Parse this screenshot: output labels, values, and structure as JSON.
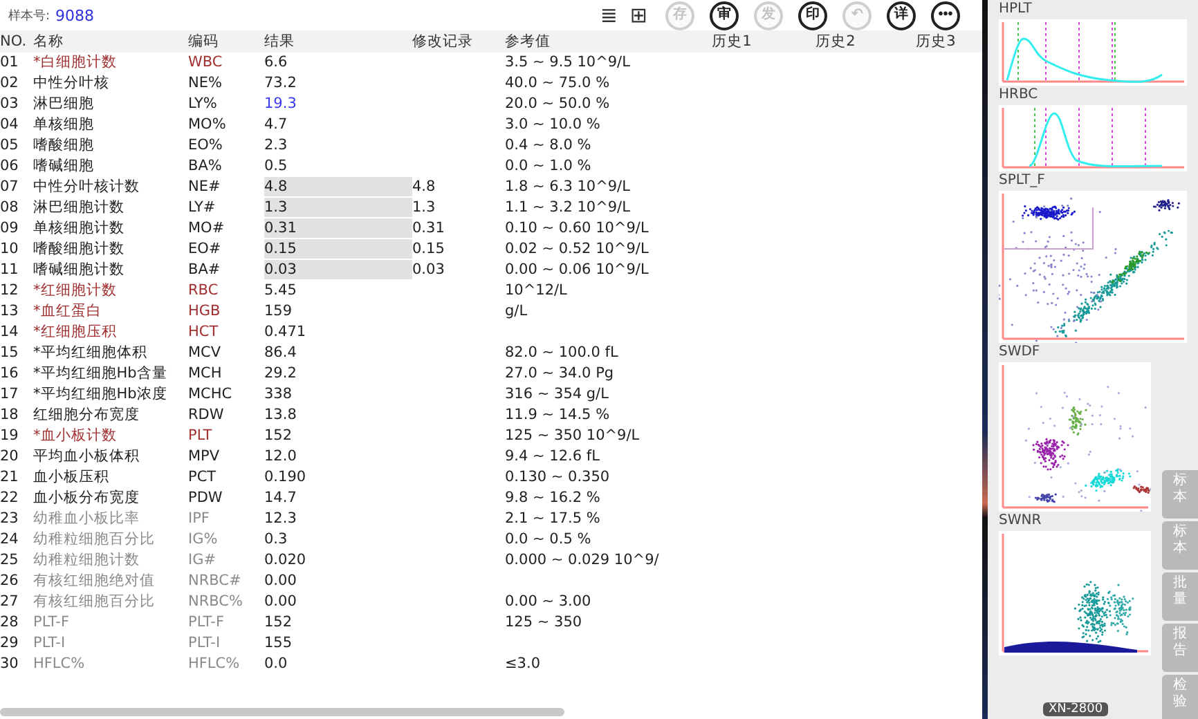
{
  "sample": {
    "label": "样本号:",
    "value": "9088"
  },
  "toolbar": [
    {
      "kind": "icon",
      "label": "≣"
    },
    {
      "kind": "icon",
      "label": "⊞"
    },
    {
      "kind": "circle",
      "label": "存",
      "disabled": true
    },
    {
      "kind": "circle",
      "label": "审",
      "disabled": false
    },
    {
      "kind": "circle",
      "label": "发",
      "disabled": true
    },
    {
      "kind": "circle",
      "label": "印",
      "disabled": false
    },
    {
      "kind": "circle",
      "label": "↶",
      "disabled": true
    },
    {
      "kind": "circle",
      "label": "详",
      "disabled": false
    },
    {
      "kind": "circle",
      "label": "•••",
      "disabled": false
    }
  ],
  "table": {
    "columns": [
      "NO.",
      "名称",
      "编码",
      "结果",
      "修改记录",
      "参考值",
      "历史1",
      "历史2",
      "历史3"
    ],
    "rows": [
      {
        "no": "01",
        "name": "*白细胞计数",
        "code": "WBC",
        "result": "6.6",
        "edit": "",
        "ref": "3.5 ~ 9.5 10^9/L",
        "kind": "key",
        "edited": false,
        "flagged": false
      },
      {
        "no": "02",
        "name": "中性分叶核",
        "code": "NE%",
        "result": "73.2",
        "edit": "",
        "ref": "40.0 ~ 75.0 %",
        "kind": "normal",
        "edited": false,
        "flagged": false
      },
      {
        "no": "03",
        "name": "淋巴细胞",
        "code": "LY%",
        "result": "19.3",
        "edit": "",
        "ref": "20.0 ~ 50.0 %",
        "kind": "normal",
        "edited": false,
        "flagged": true
      },
      {
        "no": "04",
        "name": "单核细胞",
        "code": "MO%",
        "result": "4.7",
        "edit": "",
        "ref": "3.0 ~ 10.0 %",
        "kind": "normal",
        "edited": false,
        "flagged": false
      },
      {
        "no": "05",
        "name": "嗜酸细胞",
        "code": "EO%",
        "result": "2.3",
        "edit": "",
        "ref": "0.4 ~ 8.0 %",
        "kind": "normal",
        "edited": false,
        "flagged": false
      },
      {
        "no": "06",
        "name": "嗜碱细胞",
        "code": "BA%",
        "result": "0.5",
        "edit": "",
        "ref": "0.0 ~ 1.0 %",
        "kind": "normal",
        "edited": false,
        "flagged": false
      },
      {
        "no": "07",
        "name": "中性分叶核计数",
        "code": "NE#",
        "result": "4.8",
        "edit": "4.8",
        "ref": "1.8 ~ 6.3 10^9/L",
        "kind": "normal",
        "edited": true,
        "flagged": false
      },
      {
        "no": "08",
        "name": "淋巴细胞计数",
        "code": "LY#",
        "result": "1.3",
        "edit": "1.3",
        "ref": "1.1 ~ 3.2 10^9/L",
        "kind": "normal",
        "edited": true,
        "flagged": false
      },
      {
        "no": "09",
        "name": "单核细胞计数",
        "code": "MO#",
        "result": "0.31",
        "edit": "0.31",
        "ref": "0.10 ~ 0.60 10^9/L",
        "kind": "normal",
        "edited": true,
        "flagged": false
      },
      {
        "no": "10",
        "name": "嗜酸细胞计数",
        "code": "EO#",
        "result": "0.15",
        "edit": "0.15",
        "ref": "0.02 ~ 0.52 10^9/L",
        "kind": "normal",
        "edited": true,
        "flagged": false
      },
      {
        "no": "11",
        "name": "嗜碱细胞计数",
        "code": "BA#",
        "result": "0.03",
        "edit": "0.03",
        "ref": "0.00 ~ 0.06 10^9/L",
        "kind": "normal",
        "edited": true,
        "flagged": false
      },
      {
        "no": "12",
        "name": "*红细胞计数",
        "code": "RBC",
        "result": "5.45",
        "edit": "",
        "ref": "10^12/L",
        "kind": "key",
        "edited": false,
        "flagged": false
      },
      {
        "no": "13",
        "name": "*血红蛋白",
        "code": "HGB",
        "result": "159",
        "edit": "",
        "ref": "g/L",
        "kind": "key",
        "edited": false,
        "flagged": false
      },
      {
        "no": "14",
        "name": "*红细胞压积",
        "code": "HCT",
        "result": "0.471",
        "edit": "",
        "ref": "",
        "kind": "key",
        "edited": false,
        "flagged": false
      },
      {
        "no": "15",
        "name": "*平均红细胞体积",
        "code": "MCV",
        "result": "86.4",
        "edit": "",
        "ref": "82.0 ~ 100.0 fL",
        "kind": "normal",
        "edited": false,
        "flagged": false
      },
      {
        "no": "16",
        "name": "*平均红细胞Hb含量",
        "code": "MCH",
        "result": "29.2",
        "edit": "",
        "ref": "27.0 ~ 34.0 Pg",
        "kind": "normal",
        "edited": false,
        "flagged": false
      },
      {
        "no": "17",
        "name": "*平均红细胞Hb浓度",
        "code": "MCHC",
        "result": "338",
        "edit": "",
        "ref": "316 ~ 354 g/L",
        "kind": "normal",
        "edited": false,
        "flagged": false
      },
      {
        "no": "18",
        "name": "红细胞分布宽度",
        "code": "RDW",
        "result": "13.8",
        "edit": "",
        "ref": "11.9 ~ 14.5 %",
        "kind": "normal",
        "edited": false,
        "flagged": false
      },
      {
        "no": "19",
        "name": "*血小板计数",
        "code": "PLT",
        "result": "152",
        "edit": "",
        "ref": "125 ~ 350 10^9/L",
        "kind": "key",
        "edited": false,
        "flagged": false
      },
      {
        "no": "20",
        "name": "平均血小板体积",
        "code": "MPV",
        "result": "12.0",
        "edit": "",
        "ref": "9.4 ~ 12.6 fL",
        "kind": "normal",
        "edited": false,
        "flagged": false
      },
      {
        "no": "21",
        "name": "血小板压积",
        "code": "PCT",
        "result": "0.190",
        "edit": "",
        "ref": "0.130 ~ 0.350",
        "kind": "normal",
        "edited": false,
        "flagged": false
      },
      {
        "no": "22",
        "name": "血小板分布宽度",
        "code": "PDW",
        "result": "14.7",
        "edit": "",
        "ref": "9.8 ~ 16.2 %",
        "kind": "normal",
        "edited": false,
        "flagged": false
      },
      {
        "no": "23",
        "name": "幼稚血小板比率",
        "code": "IPF",
        "result": "12.3",
        "edit": "",
        "ref": "2.1 ~ 17.5 %",
        "kind": "research",
        "edited": false,
        "flagged": false
      },
      {
        "no": "24",
        "name": "幼稚粒细胞百分比",
        "code": "IG%",
        "result": "0.3",
        "edit": "",
        "ref": "0.0 ~ 0.5 %",
        "kind": "research",
        "edited": false,
        "flagged": false
      },
      {
        "no": "25",
        "name": "幼稚粒细胞计数",
        "code": "IG#",
        "result": "0.020",
        "edit": "",
        "ref": "0.000 ~ 0.029 10^9/",
        "kind": "research",
        "edited": false,
        "flagged": false
      },
      {
        "no": "26",
        "name": "有核红细胞绝对值",
        "code": "NRBC#",
        "result": "0.00",
        "edit": "",
        "ref": "",
        "kind": "research",
        "edited": false,
        "flagged": false
      },
      {
        "no": "27",
        "name": "有核红细胞百分比",
        "code": "NRBC%",
        "result": "0.00",
        "edit": "",
        "ref": "0.00 ~ 3.00",
        "kind": "research",
        "edited": false,
        "flagged": false
      },
      {
        "no": "28",
        "name": "PLT-F",
        "code": "PLT-F",
        "result": "152",
        "edit": "",
        "ref": "125 ~ 350",
        "kind": "research",
        "edited": false,
        "flagged": false
      },
      {
        "no": "29",
        "name": "PLT-I",
        "code": "PLT-I",
        "result": "155",
        "edit": "",
        "ref": "",
        "kind": "research",
        "edited": false,
        "flagged": false
      },
      {
        "no": "30",
        "name": "HFLC%",
        "code": "HFLC%",
        "result": "0.0",
        "edit": "",
        "ref": "≤3.0",
        "kind": "research",
        "edited": false,
        "flagged": false
      }
    ]
  },
  "plots": [
    {
      "title": "HPLT",
      "kind": "histogram"
    },
    {
      "title": "HRBC",
      "kind": "histogram"
    },
    {
      "title": "SPLT_F",
      "kind": "scatter"
    },
    {
      "title": "SWDF",
      "kind": "scatter"
    },
    {
      "title": "SWNR",
      "kind": "scatter"
    }
  ],
  "side_tabs": [
    "标本",
    "标本",
    "批量",
    "报告",
    "检验"
  ],
  "status_chip": "XN-2800"
}
